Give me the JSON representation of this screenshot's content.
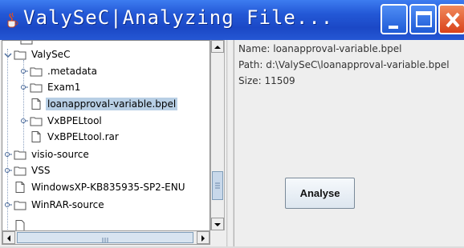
{
  "window": {
    "title": "ValySeC|Analyzing File..."
  },
  "tree": {
    "items": [
      {
        "label": "ValySeC",
        "type": "folder",
        "expanded": true
      },
      {
        "label": ".metadata",
        "type": "folder",
        "expanded": false
      },
      {
        "label": "Exam1",
        "type": "folder",
        "expanded": false
      },
      {
        "label": "loanapproval-variable.bpel",
        "type": "file",
        "selected": true
      },
      {
        "label": "VxBPELtool",
        "type": "folder",
        "expanded": false
      },
      {
        "label": "VxBPELtool.rar",
        "type": "file"
      },
      {
        "label": "visio-source",
        "type": "folder",
        "expanded": false
      },
      {
        "label": "VSS",
        "type": "folder",
        "expanded": false
      },
      {
        "label": "WindowsXP-KB835935-SP2-ENU",
        "type": "file"
      },
      {
        "label": "WinRAR-source",
        "type": "folder",
        "expanded": false
      }
    ]
  },
  "info": {
    "name": "Name: loanapproval-variable.bpel",
    "path": "Path: d:\\ValySeC\\loanapproval-variable.bpel",
    "size": "Size: 11509"
  },
  "actions": {
    "analyse_label": "Analyse"
  },
  "colors": {
    "titlebar": "#2358d6",
    "selection": "#b8cfe5",
    "close_button": "#d9421a"
  }
}
